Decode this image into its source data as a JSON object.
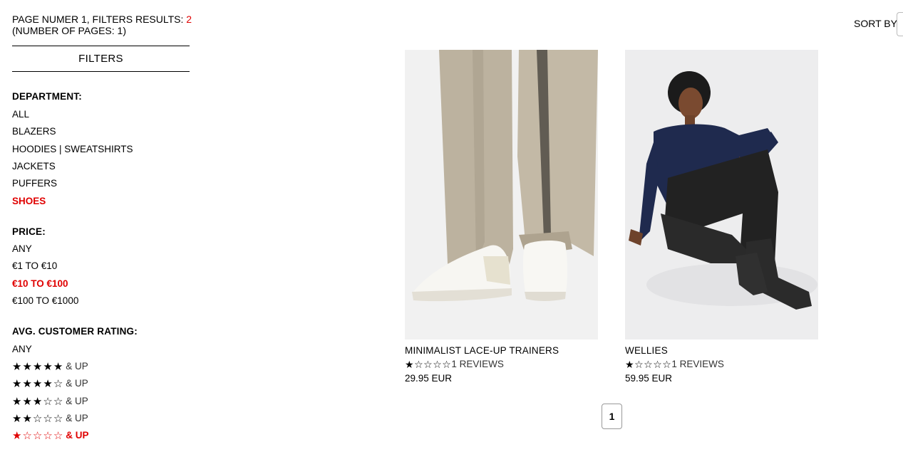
{
  "results": {
    "prefix": "PAGE NUMER 1, FILTERS RESULTS: ",
    "count": "2",
    "pages": "(NUMBER OF PAGES: 1)"
  },
  "sort": {
    "label": "SORT BY"
  },
  "filters": {
    "title": "FILTERS",
    "department": {
      "title": "DEPARTMENT:",
      "items": [
        "ALL",
        "BLAZERS",
        "HOODIES | SWEATSHIRTS",
        "JACKETS",
        "PUFFERS",
        "SHOES"
      ],
      "active": "SHOES"
    },
    "price": {
      "title": "PRICE:",
      "items": [
        "ANY",
        "€1 TO €10",
        "€10 TO €100",
        "€100 TO €1000"
      ],
      "active": "€10 TO €100"
    },
    "rating": {
      "title": "AVG. CUSTOMER RATING:",
      "any": "ANY",
      "and_up": "& UP",
      "levels": [
        5,
        4,
        3,
        2,
        1
      ],
      "active": 1
    }
  },
  "products": [
    {
      "name": "MINIMALIST LACE-UP TRAINERS",
      "stars": 1,
      "reviews": "1 REVIEWS",
      "price": "29.95 EUR"
    },
    {
      "name": "WELLIES",
      "stars": 1,
      "reviews": "1 REVIEWS",
      "price": "59.95 EUR"
    }
  ],
  "pagination": {
    "current": "1"
  }
}
